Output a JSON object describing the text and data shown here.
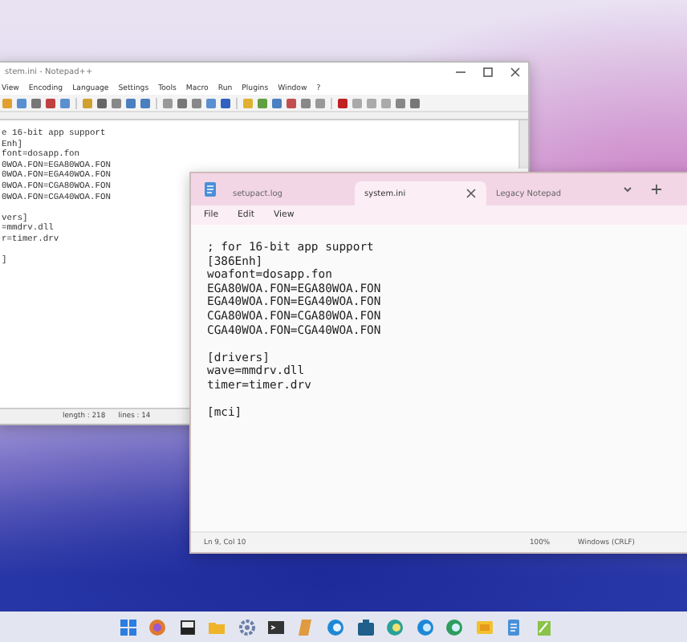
{
  "back_window": {
    "title": "stem.ini - Notepad++",
    "menu": [
      "View",
      "Encoding",
      "Language",
      "Settings",
      "Tools",
      "Macro",
      "Run",
      "Plugins",
      "Window",
      "?"
    ],
    "blocks": [
      [
        "e 16-bit app support",
        "Enh]",
        "font=dosapp.fon",
        "0WOA.FON=EGA80WOA.FON",
        "0WOA.FON=EGA40WOA.FON",
        "0WOA.FON=CGA80WOA.FON",
        "0WOA.FON=CGA40WOA.FON"
      ],
      [
        "vers]",
        "=mmdrv.dll",
        "r=timer.drv"
      ],
      [
        "]"
      ]
    ],
    "status": [
      "length : 218",
      "lines : 14"
    ]
  },
  "front_window": {
    "tabs": [
      {
        "label": "setupact.log",
        "selected": false
      },
      {
        "label": "system.ini",
        "selected": true
      },
      {
        "label": "Legacy Notepad",
        "selected": false
      }
    ],
    "menu": [
      "File",
      "Edit",
      "View"
    ],
    "blocks": [
      [
        "; for 16-bit app support",
        "[386Enh]",
        "woafont=dosapp.fon",
        "EGA80WOA.FON=EGA80WOA.FON",
        "EGA40WOA.FON=EGA40WOA.FON",
        "CGA80WOA.FON=CGA80WOA.FON",
        "CGA40WOA.FON=CGA40WOA.FON"
      ],
      [
        "[drivers]",
        "wave=mmdrv.dll",
        "timer=timer.drv"
      ],
      [
        "[mci]"
      ]
    ],
    "status": [
      "Ln 9, Col 10",
      "100%",
      "Windows (CRLF)"
    ]
  }
}
